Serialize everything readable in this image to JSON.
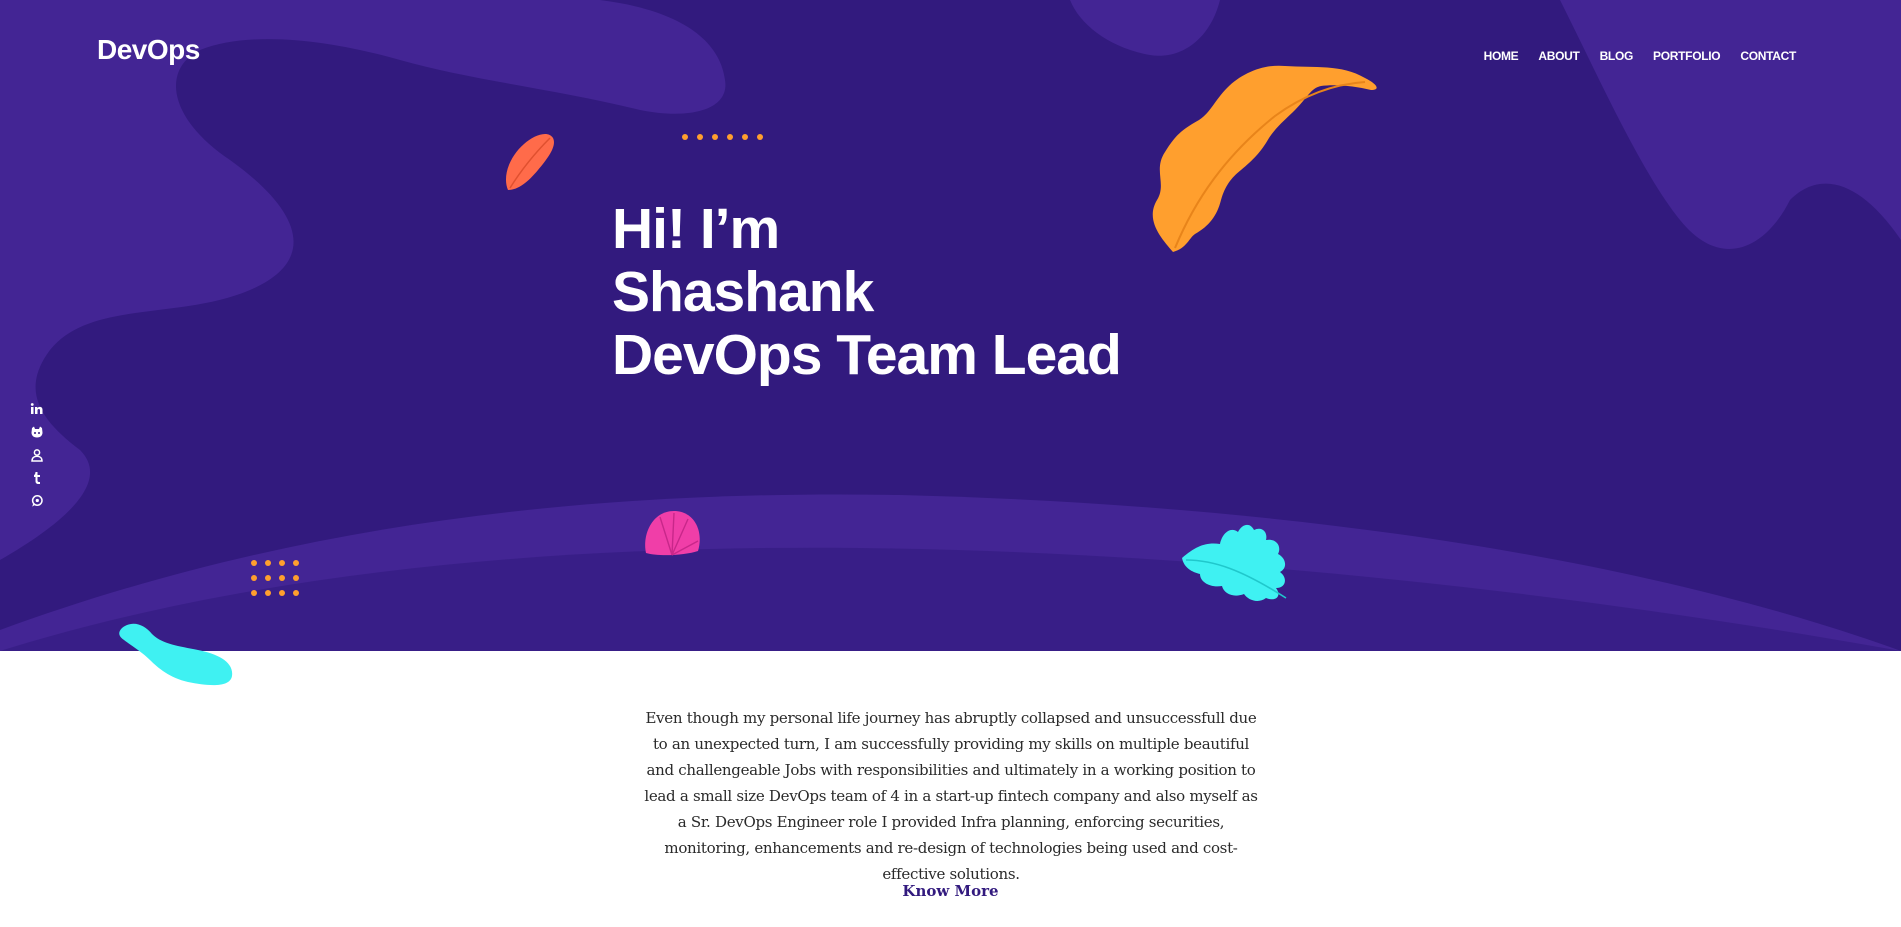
{
  "brand": {
    "logo": "DevOps"
  },
  "nav": {
    "items": [
      {
        "label": "HOME"
      },
      {
        "label": "ABOUT"
      },
      {
        "label": "BLOG"
      },
      {
        "label": "PORTFOLIO"
      },
      {
        "label": "CONTACT"
      }
    ]
  },
  "hero": {
    "line1": "Hi! I’m",
    "line2": "Shashank",
    "line3": "DevOps Team Lead"
  },
  "social": {
    "icons": [
      "linkedin-icon",
      "github-icon",
      "user-icon",
      "tumblr-icon",
      "whatsapp-icon"
    ]
  },
  "about": {
    "text": "Even though my personal life journey has abruptly collapsed and unsuccessfull due to an unexpected turn, I am successfully providing my skills on multiple beautiful and challengeable Jobs with responsibilities and ultimately in a working position to lead a small size DevOps team of 4 in a start-up fintech company and also myself as a Sr. DevOps Engineer role I provided Infra planning, enforcing securities, monitoring, enhancements and re-design of technologies being used and cost-effective solutions.",
    "cta": "Know More"
  },
  "colors": {
    "hero_bg": "#321a7e",
    "hero_blob": "#432594",
    "accent_orange": "#ff9f2e",
    "accent_cyan": "#3ff1f2",
    "accent_pink": "#f03ea8",
    "accent_coral": "#ff6b4a",
    "link": "#321a7e"
  }
}
